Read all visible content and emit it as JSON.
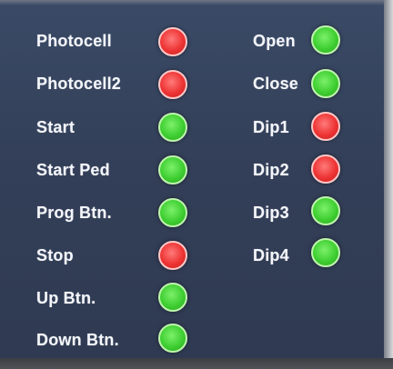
{
  "left_column": [
    {
      "label": "Photocell",
      "state": "red"
    },
    {
      "label": "Photocell2",
      "state": "red"
    },
    {
      "label": "Start",
      "state": "green"
    },
    {
      "label": "Start Ped",
      "state": "green"
    },
    {
      "label": "Prog Btn.",
      "state": "green"
    },
    {
      "label": "Stop",
      "state": "red"
    },
    {
      "label": "Up Btn.",
      "state": "green"
    },
    {
      "label": "Down Btn.",
      "state": "green"
    }
  ],
  "right_column": [
    {
      "label": "Open",
      "state": "green"
    },
    {
      "label": "Close",
      "state": "green"
    },
    {
      "label": "Dip1",
      "state": "red"
    },
    {
      "label": "Dip2",
      "state": "red"
    },
    {
      "label": "Dip3",
      "state": "green"
    },
    {
      "label": "Dip4",
      "state": "green"
    }
  ],
  "colors": {
    "background": "#333f58",
    "indicator_on": "#3fcf32",
    "indicator_off": "#ee3434",
    "label_text": "#f4f6fb"
  }
}
